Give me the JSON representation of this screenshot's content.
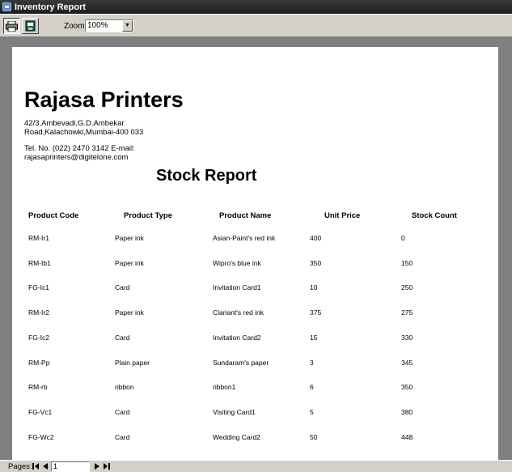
{
  "window": {
    "title": "Inventory Report"
  },
  "toolbar": {
    "zoom_label": "Zoom",
    "zoom_value": "100%"
  },
  "report": {
    "company": "Rajasa Printers",
    "address": "42/3,Ambevadi,G.D.Ambekar Road,Kalachowki,Mumbai-400 033",
    "contact": "Tel. No. (022) 2470 3142 E-mail: rajasaprinters@digitelone.com",
    "title": "Stock Report",
    "columns": [
      "Product Code",
      "Product Type",
      "Product Name",
      "Unit Price",
      "Stock Count"
    ],
    "rows": [
      [
        "RM-Ir1",
        "Paper ink",
        "Asian-Paint's red ink",
        "400",
        "0"
      ],
      [
        "RM-Ib1",
        "Paper ink",
        "Wipro's blue ink",
        "350",
        "150"
      ],
      [
        "FG-Ic1",
        "Card",
        "Invitation Card1",
        "10",
        "250"
      ],
      [
        "RM-Ir2",
        "Paper ink",
        "Clariant's red ink",
        "375",
        "275"
      ],
      [
        "FG-Ic2",
        "Card",
        "Invitation Card2",
        "15",
        "330"
      ],
      [
        "RM-Pp",
        "Plain paper",
        "Sundaram's paper",
        "3",
        "345"
      ],
      [
        "RM-rb",
        "ribbon",
        "ribbon1",
        "6",
        "350"
      ],
      [
        "FG-Vc1",
        "Card",
        "Visiting Card1",
        "5",
        "380"
      ],
      [
        "FG-Wc2",
        "Card",
        "Wedding Card2",
        "50",
        "448"
      ]
    ]
  },
  "statusbar": {
    "pages_label": "Pages:",
    "page_value": "1"
  }
}
